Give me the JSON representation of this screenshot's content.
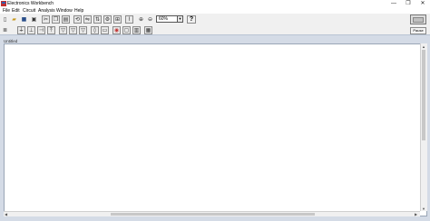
{
  "window": {
    "title": "Electronics Workbench",
    "minimize_glyph": "—",
    "maximize_glyph": "❐",
    "close_glyph": "✕"
  },
  "menu": [
    "File",
    "Edit",
    "Circuit",
    "Analysis",
    "Window",
    "Help"
  ],
  "toolbar": {
    "zoom_value": "60%",
    "help_label": "?",
    "pause_label": "Pause"
  },
  "document": {
    "title": "Untitled"
  },
  "icons": {
    "app": "app-icon",
    "new": "new-file-icon",
    "open": "open-folder-icon",
    "save": "save-icon",
    "print": "print-icon",
    "cut": "cut-icon",
    "copy": "copy-icon",
    "paste": "paste-icon",
    "zoom_in": "zoom-in-icon",
    "zoom_out": "zoom-out-icon"
  },
  "colors": {
    "workspace_bg": "#d4dbe6",
    "toolbar_bg": "#f0f0f0"
  }
}
